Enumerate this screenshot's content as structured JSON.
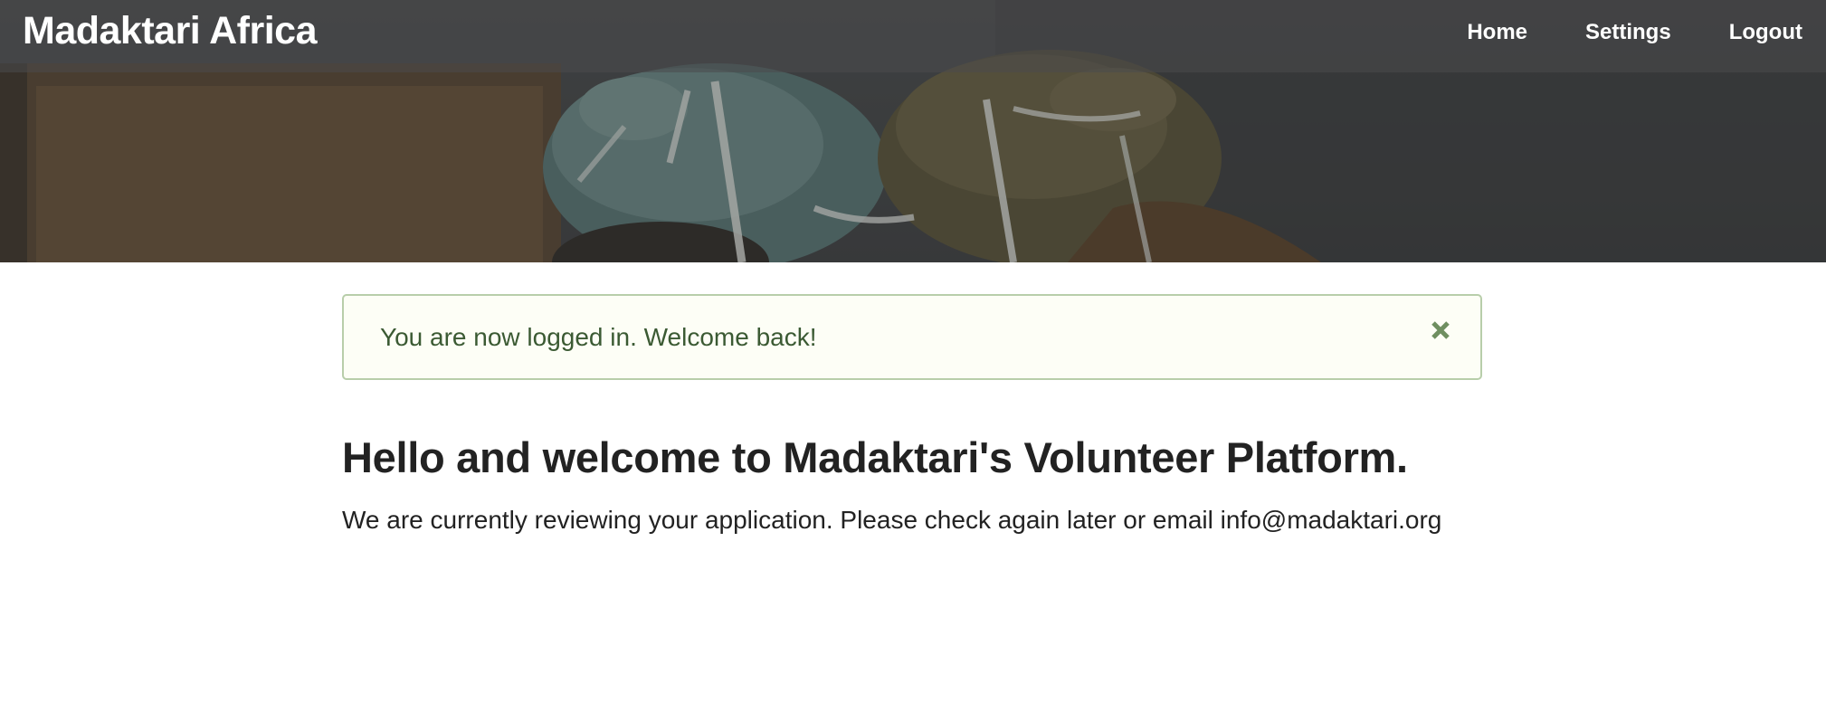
{
  "header": {
    "brand": "Madaktari Africa",
    "nav": [
      {
        "label": "Home"
      },
      {
        "label": "Settings"
      },
      {
        "label": "Logout"
      }
    ]
  },
  "alert": {
    "message": "You are now logged in. Welcome back!",
    "close_icon": "close-icon"
  },
  "main": {
    "heading": "Hello and welcome to Madaktari's Volunteer Platform.",
    "status_text": "We are currently reviewing your application. Please check again later or email info@madaktari.org"
  },
  "colors": {
    "alert_bg": "#fdfef6",
    "alert_border": "#b8ceaa",
    "alert_text": "#3b5a33",
    "close_icon": "#6f8f60"
  }
}
